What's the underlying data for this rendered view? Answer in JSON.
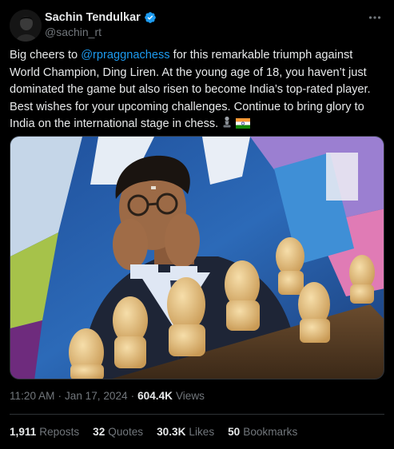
{
  "author": {
    "display_name": "Sachin Tendulkar",
    "handle": "@sachin_rt",
    "verified": true,
    "accent_color": "#1d9bf0"
  },
  "tweet": {
    "text_before_mention": "Big cheers to ",
    "mention": "@rpraggnachess",
    "text_after_mention": " for this remarkable triumph against World Champion, Ding Liren. At the young age of 18, you haven’t just dominated the game but also risen to become India’s top-rated player. Best wishes for your upcoming challenges. Continue to bring glory to India on the international stage in chess.",
    "emojis": [
      "chess-pawn",
      "india-flag"
    ]
  },
  "meta": {
    "time": "11:20 AM",
    "date": "Jan 17, 2024",
    "separator": "·",
    "views_count": "604.4K",
    "views_label": "Views"
  },
  "stats": {
    "reposts_count": "1,911",
    "reposts_label": "Reposts",
    "quotes_count": "32",
    "quotes_label": "Quotes",
    "likes_count": "30.3K",
    "likes_label": "Likes",
    "bookmarks_count": "50",
    "bookmarks_label": "Bookmarks"
  },
  "colors": {
    "background": "#000000",
    "text": "#e7e9ea",
    "secondary": "#71767b",
    "link": "#1d9bf0",
    "divider": "#2f3336"
  }
}
